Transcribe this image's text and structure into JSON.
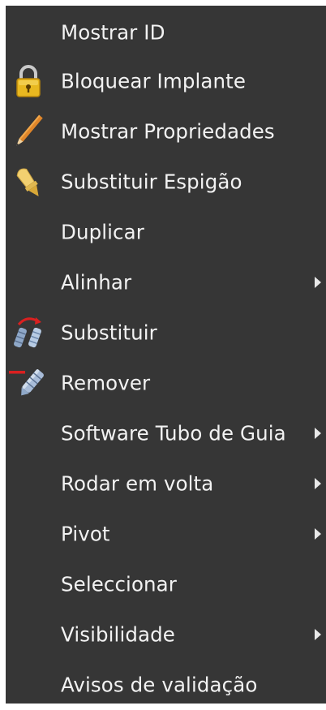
{
  "menu": {
    "items": [
      {
        "label": "Mostrar ID",
        "icon": null,
        "submenu": false
      },
      {
        "label": "Bloquear Implante",
        "icon": "lock-icon",
        "submenu": false
      },
      {
        "label": "Mostrar Propriedades",
        "icon": "pencil-icon",
        "submenu": false
      },
      {
        "label": "Substituir Espigão",
        "icon": "abutment-icon",
        "submenu": false
      },
      {
        "label": "Duplicar",
        "icon": null,
        "submenu": false
      },
      {
        "label": "Alinhar",
        "icon": null,
        "submenu": true
      },
      {
        "label": "Substituir",
        "icon": "replace-implant-icon",
        "submenu": false
      },
      {
        "label": "Remover",
        "icon": "remove-implant-icon",
        "submenu": false
      },
      {
        "label": "Software Tubo de Guia",
        "icon": null,
        "submenu": true
      },
      {
        "label": "Rodar em volta",
        "icon": null,
        "submenu": true
      },
      {
        "label": "Pivot",
        "icon": null,
        "submenu": true
      },
      {
        "label": "Seleccionar",
        "icon": null,
        "submenu": false
      },
      {
        "label": "Visibilidade",
        "icon": null,
        "submenu": true
      },
      {
        "label": "Avisos de validação",
        "icon": null,
        "submenu": false
      }
    ]
  },
  "colors": {
    "menu_background": "#363636",
    "text": "#f2f2f2",
    "lock_gold": "#e8b820",
    "pencil_orange": "#e0862a",
    "remove_red": "#d92020",
    "implant_steel": "#8fa8c8"
  }
}
